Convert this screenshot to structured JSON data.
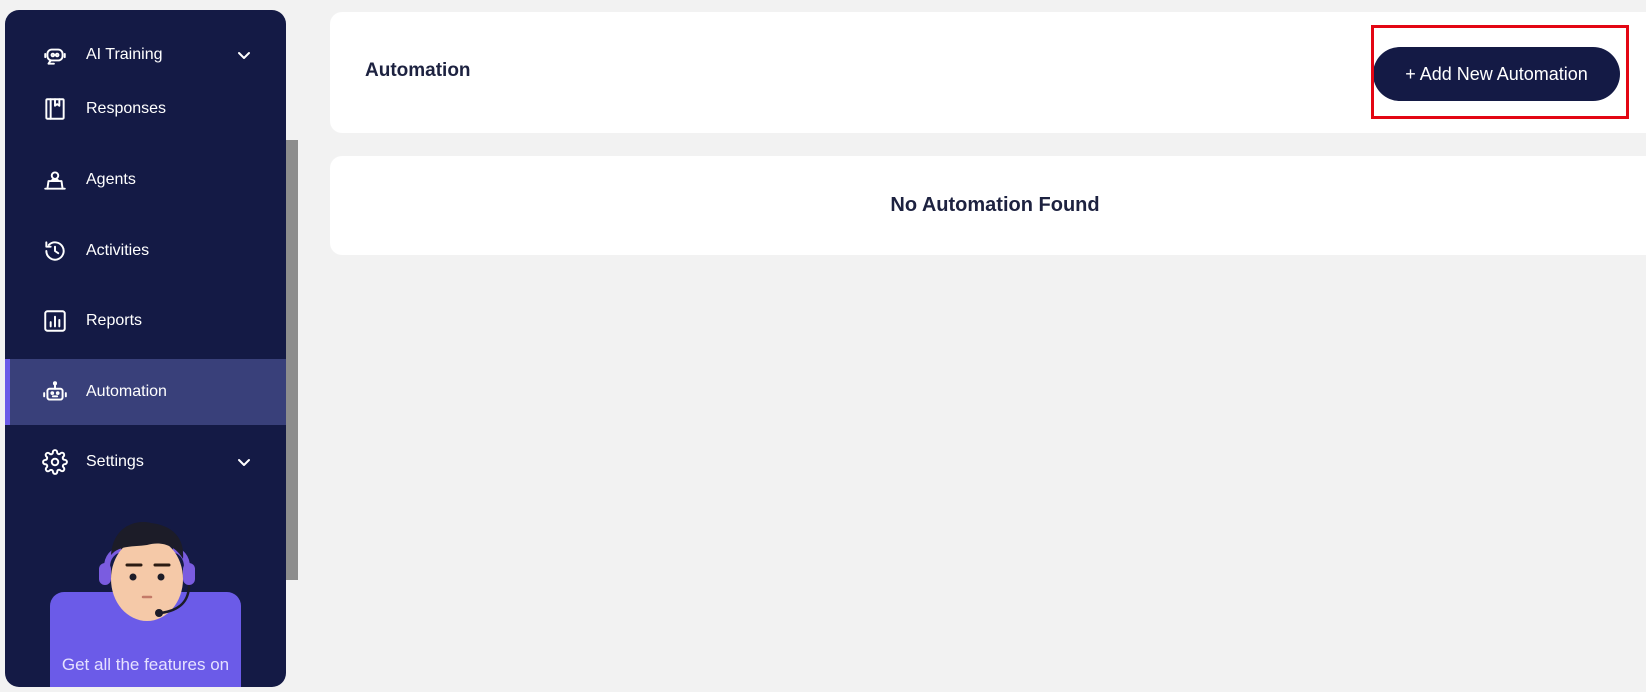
{
  "sidebar": {
    "items": [
      {
        "label": "AI Training",
        "icon": "ai-training-icon",
        "has_chevron": true
      },
      {
        "label": "Responses",
        "icon": "book-icon"
      },
      {
        "label": "Agents",
        "icon": "agent-icon"
      },
      {
        "label": "Activities",
        "icon": "history-icon"
      },
      {
        "label": "Reports",
        "icon": "bar-chart-icon"
      },
      {
        "label": "Automation",
        "icon": "robot-icon",
        "active": true
      },
      {
        "label": "Settings",
        "icon": "gear-icon",
        "has_chevron": true
      }
    ],
    "promo": {
      "text": "Get all the features on"
    }
  },
  "header": {
    "title": "Automation",
    "add_button_label": "+ Add New Automation"
  },
  "main": {
    "empty_message": "No Automation Found"
  },
  "colors": {
    "sidebar_bg": "#141a45",
    "active_bg": "#39407a",
    "accent": "#6b5be8",
    "highlight": "#e30613"
  }
}
